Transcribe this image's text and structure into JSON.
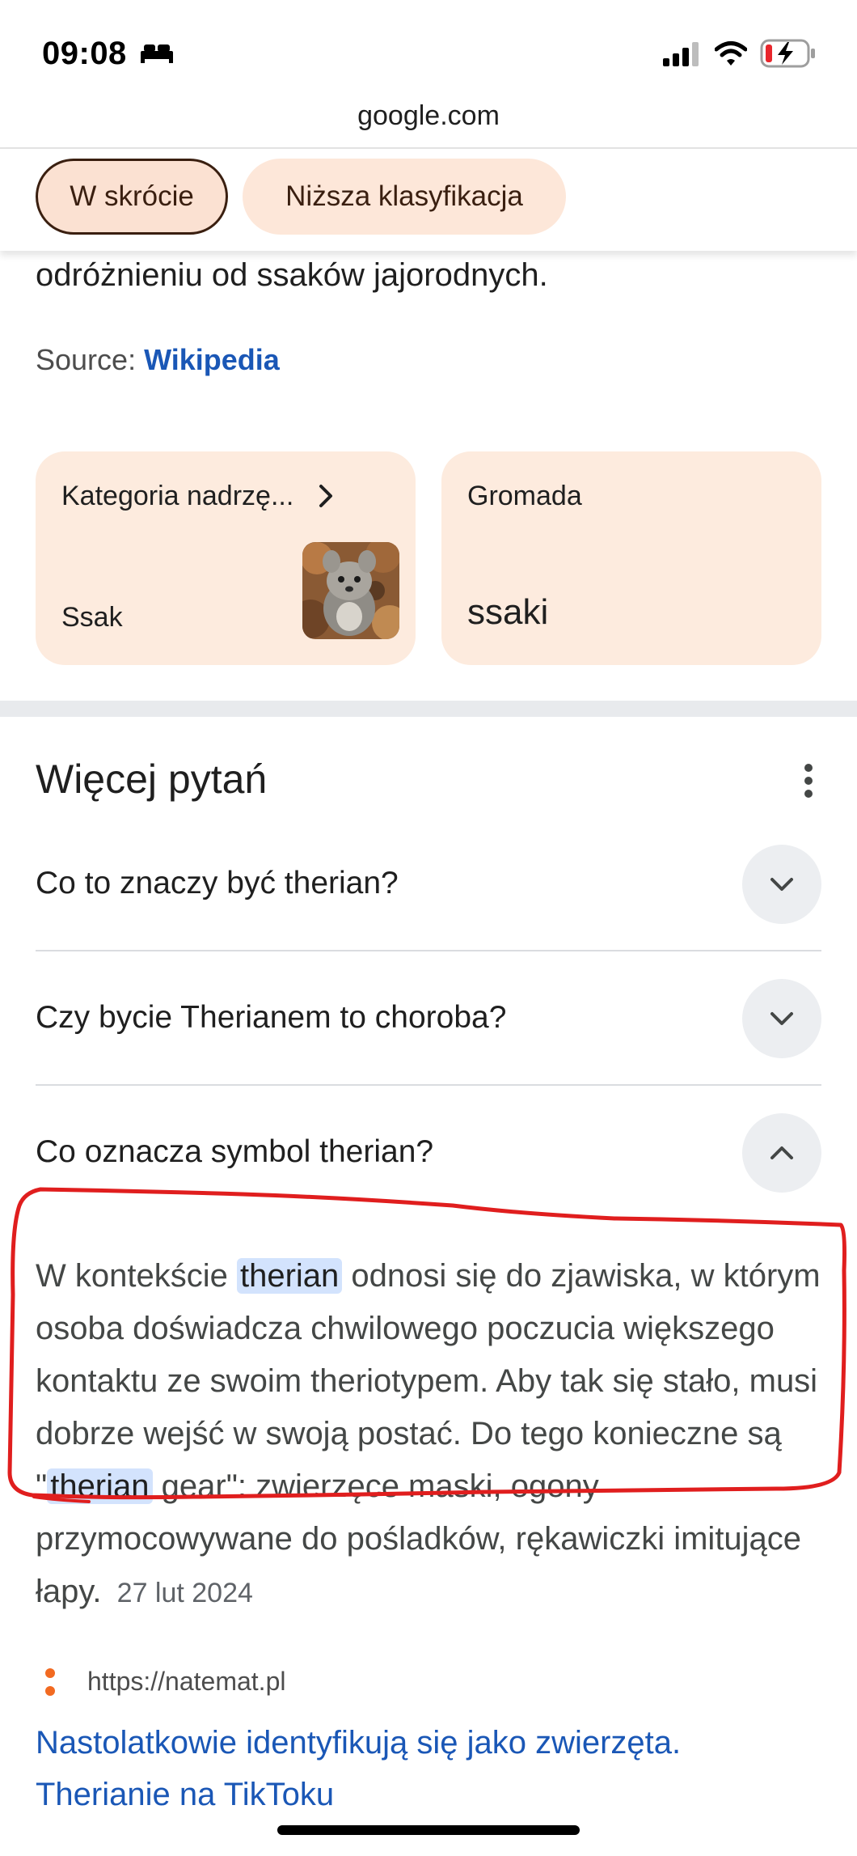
{
  "status_bar": {
    "time": "09:08"
  },
  "browser": {
    "domain": "google.com"
  },
  "chips": [
    {
      "label": "W skrócie",
      "active": true
    },
    {
      "label": "Niższa klasyfikacja",
      "active": false
    }
  ],
  "content": {
    "lead_text": "odróżnieniu od ssaków jajorodnych.",
    "source_label": "Source: ",
    "source_link": "Wikipedia"
  },
  "cards": [
    {
      "title": "Kategoria nadrzę...",
      "value": "Ssak"
    },
    {
      "title": "Gromada",
      "value": "ssaki"
    }
  ],
  "more_questions": {
    "title": "Więcej pytań",
    "questions": [
      {
        "text": "Co to znaczy być therian?",
        "expanded": false
      },
      {
        "text": "Czy bycie Therianem to choroba?",
        "expanded": false
      },
      {
        "text": "Co oznacza symbol therian?",
        "expanded": true
      }
    ],
    "answer": {
      "p1": "W kontekście ",
      "hl1": "therian",
      "p2": " odnosi się do zjawiska, w którym osoba doświadcza chwilowego poczucia większego kontaktu ze swoim theriotypem. Aby tak się stało, musi dobrze wejść w swoją postać. Do tego konieczne są \"",
      "hl2": "therian",
      "p3": " gear\": zwierzęce maski, ogony przymocowywane do pośladków, rękawiczki imitujące łapy.",
      "date": "27 lut 2024"
    },
    "source_url": "https://natemat.pl",
    "source_title": "Nastolatkowie identyfikują się jako zwierzęta. Therianie na TikToku"
  },
  "colors": {
    "chip_bg": "#fde7d9",
    "link": "#1a57b6",
    "highlight": "#d3e3fd",
    "annotation": "#e01e1e"
  }
}
